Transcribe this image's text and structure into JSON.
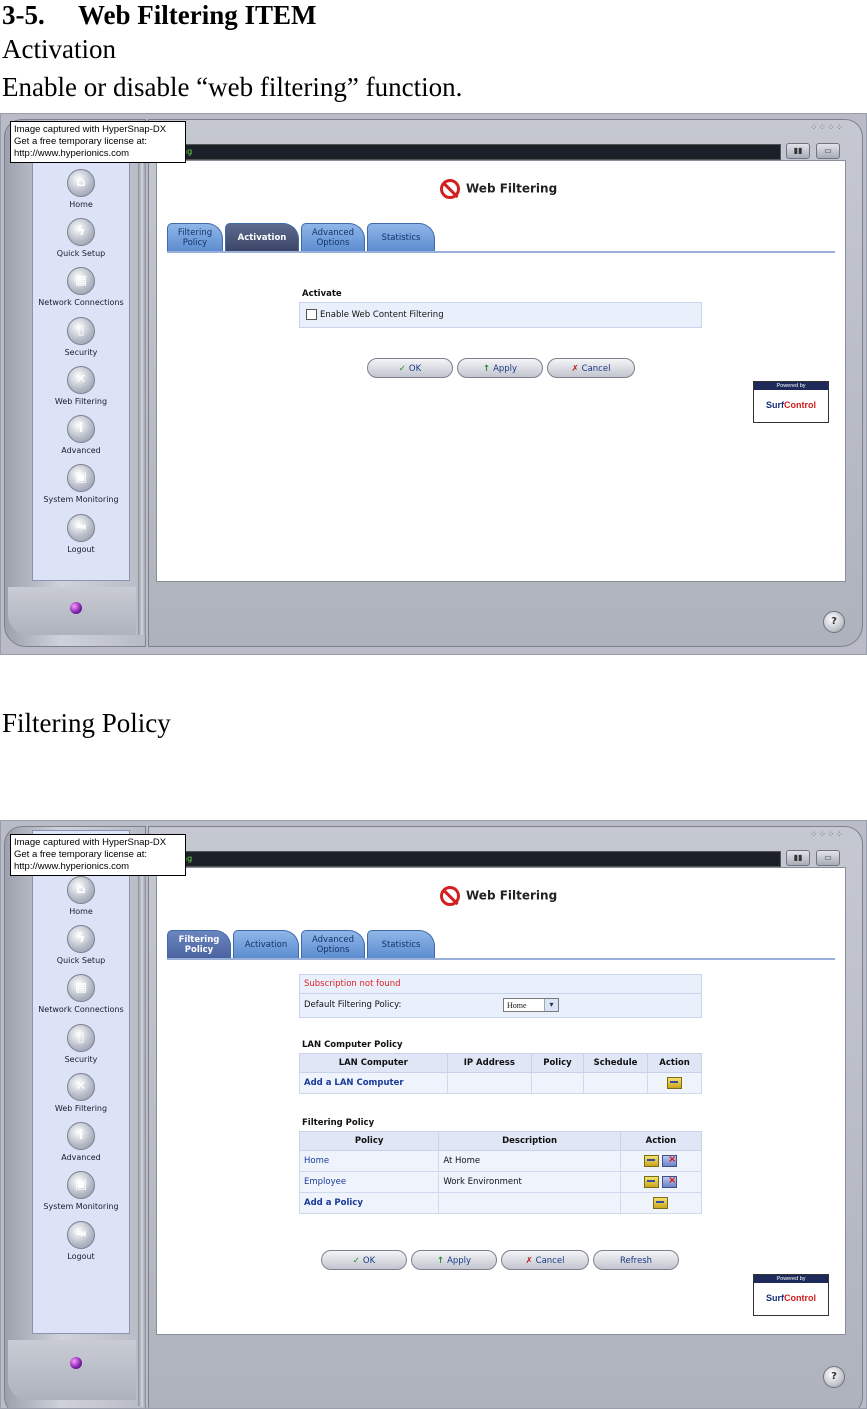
{
  "doc": {
    "heading_number": "3-5.",
    "heading_title": "Web Filtering ITEM",
    "activation_label": "Activation",
    "activation_desc": "Enable or disable “web filtering” function.",
    "filtering_policy_label": "Filtering Policy"
  },
  "watermark": {
    "line1": "Image captured with HyperSnap-DX",
    "line2": "Get a free temporary license at:",
    "line3": "http://www.hyperionics.com"
  },
  "window": {
    "title_strip": "Filtering"
  },
  "sidebar": {
    "items": [
      {
        "label": "Home",
        "icon": "home-icon"
      },
      {
        "label": "Quick Setup",
        "icon": "lightning-icon"
      },
      {
        "label": "Network Connections",
        "icon": "network-icon"
      },
      {
        "label": "Security",
        "icon": "lock-icon"
      },
      {
        "label": "Web Filtering",
        "icon": "web-filter-icon"
      },
      {
        "label": "Advanced",
        "icon": "advanced-icon"
      },
      {
        "label": "System Monitoring",
        "icon": "monitor-icon"
      },
      {
        "label": "Logout",
        "icon": "logout-icon"
      }
    ]
  },
  "page": {
    "title": "Web Filtering",
    "tabs": [
      "Filtering Policy",
      "Activation",
      "Advanced Options",
      "Statistics"
    ]
  },
  "activation": {
    "section_title": "Activate",
    "checkbox_label": "Enable Web Content Filtering",
    "checkbox_checked": false,
    "buttons": {
      "ok": "OK",
      "apply": "Apply",
      "cancel": "Cancel"
    }
  },
  "policy": {
    "subscription_msg": "Subscription not found",
    "default_label": "Default Filtering Policy:",
    "default_value": "Home",
    "lan_title": "LAN Computer Policy",
    "lan_headers": [
      "LAN Computer",
      "IP Address",
      "Policy",
      "Schedule",
      "Action"
    ],
    "lan_add": "Add a LAN Computer",
    "fp_title": "Filtering Policy",
    "fp_headers": [
      "Policy",
      "Description",
      "Action"
    ],
    "fp_rows": [
      {
        "policy": "Home",
        "description": "At Home"
      },
      {
        "policy": "Employee",
        "description": "Work Environment"
      }
    ],
    "fp_add": "Add a Policy",
    "buttons": {
      "ok": "OK",
      "apply": "Apply",
      "cancel": "Cancel",
      "refresh": "Refresh"
    }
  },
  "badge": {
    "top": "Powered by",
    "brand_a": "Surf",
    "brand_b": "Control"
  },
  "colors": {
    "active_tab": "#3b4566",
    "tab": "#5d8dd0",
    "title_text": "#6cd84c",
    "subscription": "#dd2222"
  }
}
